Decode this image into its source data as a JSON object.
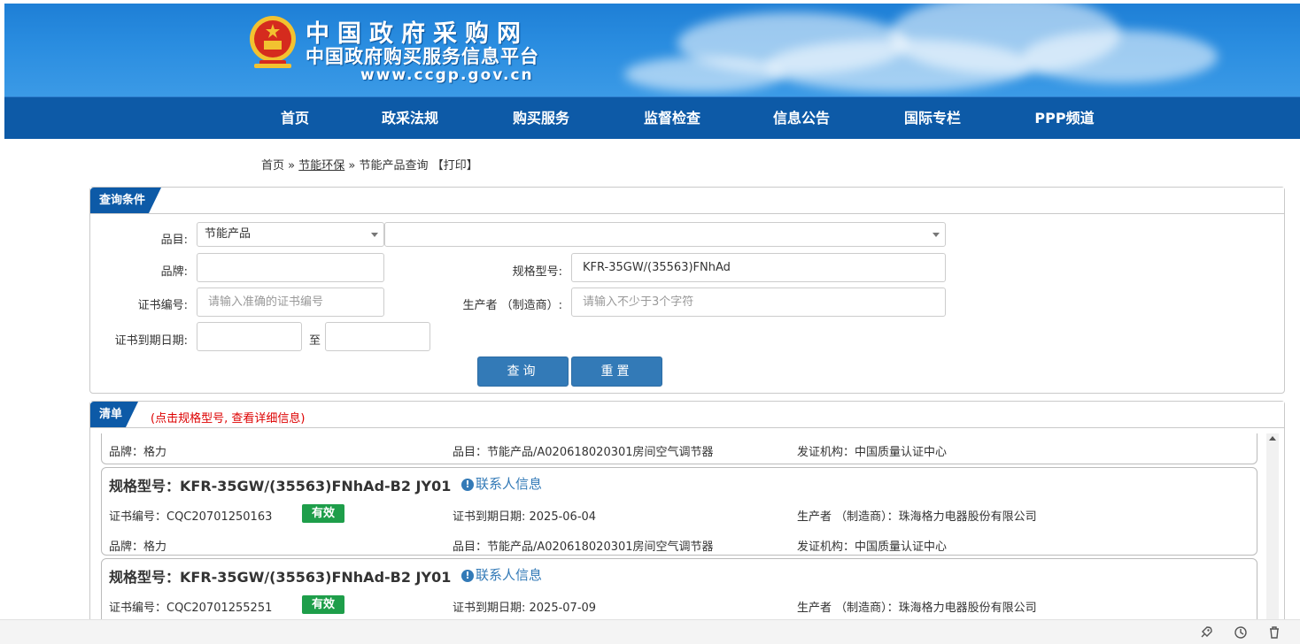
{
  "header": {
    "title": "中国政府采购网",
    "subtitle": "中国政府购买服务信息平台",
    "url": "www.ccgp.gov.cn"
  },
  "nav": [
    "首页",
    "政采法规",
    "购买服务",
    "监督检查",
    "信息公告",
    "国际专栏",
    "PPP频道"
  ],
  "breadcrumb": {
    "home": "首页",
    "sep1": "»",
    "section": "节能环保",
    "sep2": "»",
    "page": "节能产品查询",
    "print": "【打印】"
  },
  "query": {
    "panel_title": "查询条件",
    "category_label": "品目:",
    "category_value": "节能产品",
    "subcategory_value": "",
    "brand_label": "品牌:",
    "brand_value": "",
    "model_label": "规格型号:",
    "model_value": "KFR-35GW/(35563)FNhAd",
    "cert_label": "证书编号:",
    "cert_placeholder": "请输入准确的证书编号",
    "maker_label": "生产者 （制造商）:",
    "maker_placeholder": "请输入不少于3个字符",
    "expiry_label": "证书到期日期:",
    "expiry_to": "至",
    "search_button": "查询",
    "reset_button": "重置"
  },
  "list": {
    "panel_title": "清单",
    "hint": "(点击规格型号, 查看详细信息)",
    "partial_row": {
      "brand": "品牌：格力",
      "category": "品目：节能产品/A020618020301房间空气调节器",
      "issuer": "发证机构：中国质量认证中心"
    },
    "items": [
      {
        "model": "规格型号：KFR-35GW/(35563)FNhAd-B2 JY01",
        "contact": "联系人信息",
        "cert": "证书编号：CQC20701250163",
        "status": "有效",
        "expiry": "证书到期日期: 2025-06-04",
        "maker": "生产者 （制造商）：珠海格力电器股份有限公司",
        "brand": "品牌：格力",
        "category": "品目：节能产品/A020618020301房间空气调节器",
        "issuer": "发证机构：中国质量认证中心"
      },
      {
        "model": "规格型号：KFR-35GW/(35563)FNhAd-B2 JY01",
        "contact": "联系人信息",
        "cert": "证书编号：CQC20701255251",
        "status": "有效",
        "expiry": "证书到期日期: 2025-07-09",
        "maker": "生产者 （制造商）：珠海格力电器股份有限公司"
      }
    ]
  },
  "colors": {
    "nav_bg": "#0d5aa7",
    "button": "#337ab7",
    "valid_badge": "#1e9e4a",
    "hint_red": "#dd0000"
  }
}
